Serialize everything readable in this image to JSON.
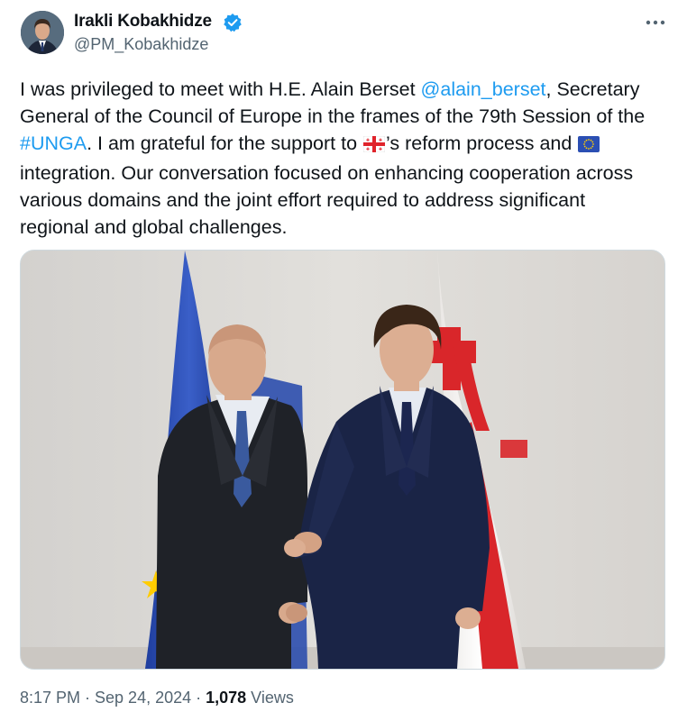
{
  "author": {
    "name": "Irakli Kobakhidze",
    "handle": "@PM_Kobakhidze",
    "verified": true
  },
  "tweet": {
    "line1_a": "I was privileged to meet with H.E. Alain Berset ",
    "mention": "@alain_berset",
    "line1_b": ", Secretary",
    "line2": "General of the Council of Europe in the frames of the 79th Session of the",
    "hashtag": "#UNGA",
    "line3_a": ". I am grateful for the support to ",
    "line3_b": "’s reform process and ",
    "line4": "integration. Our conversation focused on enhancing cooperation across",
    "line5": "various domains and the joint effort required to address significant",
    "line6": "regional and global challenges.",
    "emoji_1": "georgia-flag-emoji",
    "emoji_2": "eu-flag-emoji"
  },
  "meta": {
    "time_date": "8:17 PM · Sep 24, 2024 · ",
    "views_count": "1,078",
    "views_label": " Views"
  },
  "icons": {
    "verified": "verified-badge-icon",
    "more": "more-options-icon"
  },
  "colors": {
    "link": "#1d9bf0",
    "verified": "#1d9bf0",
    "secondary_text": "#536471",
    "eu_blue": "#2b4fb3",
    "georgia_red": "#d9262a"
  }
}
